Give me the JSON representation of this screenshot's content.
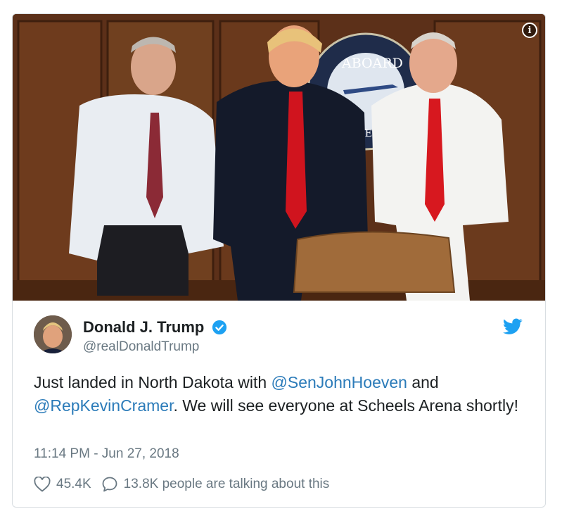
{
  "author": {
    "name": "Donald J. Trump",
    "handle": "@realDonaldTrump",
    "verified_icon": "verified-badge-icon",
    "avatar_alt": "avatar"
  },
  "photo": {
    "seal_text": "ABOARD",
    "seal_text2": "CE"
  },
  "tweet": {
    "text_part1": "Just landed in North Dakota with ",
    "mention1": "@SenJohnHoeven",
    "text_part2": " and ",
    "mention2": "@RepKevinCramer",
    "text_part3": ". We will see everyone at Scheels Arena shortly!",
    "timestamp": "11:14 PM - Jun 27, 2018"
  },
  "actions": {
    "likes": "45.4K",
    "replies_label": "13.8K people are talking about this"
  },
  "colors": {
    "link": "#2b7bb9",
    "secondary": "#697882",
    "primary_text": "#1c2022",
    "twitter_blue": "#1da1f2"
  }
}
